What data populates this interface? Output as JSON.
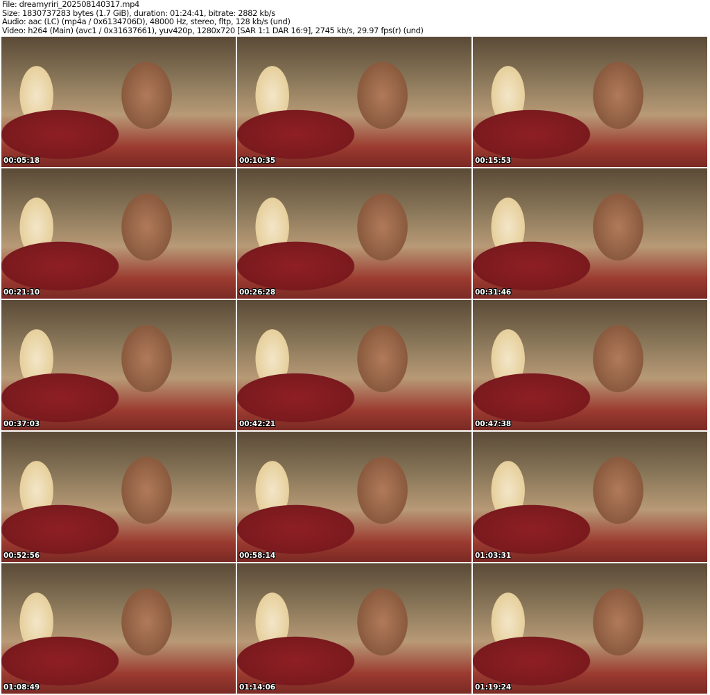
{
  "header": {
    "file": "File: dreamyriri_202508140317.mp4",
    "size": "Size: 1830737283 bytes (1.7 GiB), duration: 01:24:41, bitrate: 2882 kb/s",
    "audio": "Audio: aac (LC) (mp4a / 0x6134706D), 48000 Hz, stereo, fltp, 128 kb/s (und)",
    "video": "Video: h264 (Main) (avc1 / 0x31637661), yuv420p, 1280x720 [SAR 1:1 DAR 16:9], 2745 kb/s, 29.97 fps(r) (und)"
  },
  "thumbnails": [
    {
      "timestamp": "00:05:18"
    },
    {
      "timestamp": "00:10:35"
    },
    {
      "timestamp": "00:15:53"
    },
    {
      "timestamp": "00:21:10"
    },
    {
      "timestamp": "00:26:28"
    },
    {
      "timestamp": "00:31:46"
    },
    {
      "timestamp": "00:37:03"
    },
    {
      "timestamp": "00:42:21"
    },
    {
      "timestamp": "00:47:38"
    },
    {
      "timestamp": "00:52:56"
    },
    {
      "timestamp": "00:58:14"
    },
    {
      "timestamp": "01:03:31"
    },
    {
      "timestamp": "01:08:49"
    },
    {
      "timestamp": "01:14:06"
    },
    {
      "timestamp": "01:19:24"
    }
  ]
}
